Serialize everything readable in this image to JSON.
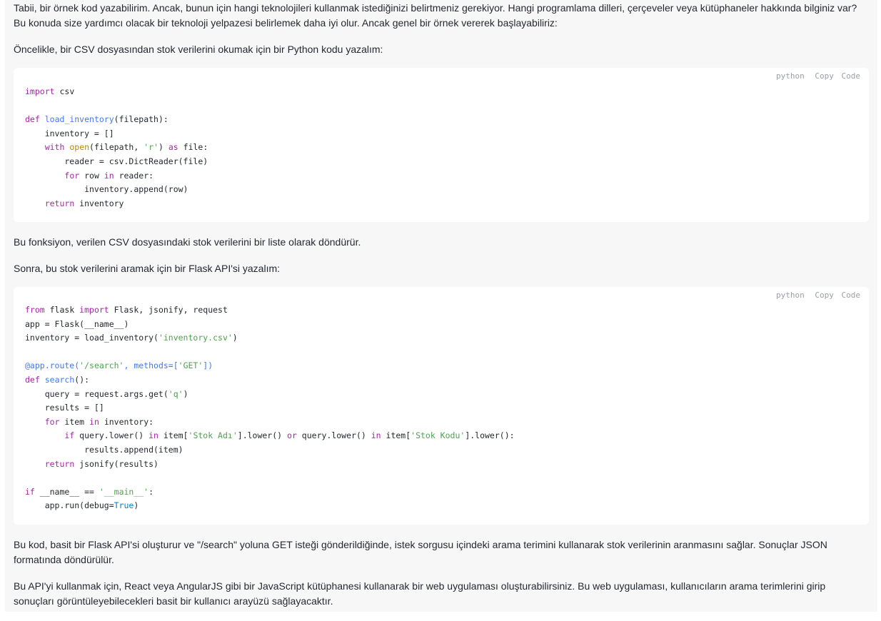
{
  "paragraphs": {
    "intro": "Tabii, bir örnek kod yazabilirim. Ancak, bunun için hangi teknolojileri kullanmak istediğinizi belirtmeniz gerekiyor. Hangi programlama dilleri, çerçeveler veya kütüphaneler hakkında bilginiz var? Bu konuda size yardımcı olacak bir teknoloji yelpazesi belirlemek daha iyi olur. Ancak genel bir örnek vererek başlayabiliriz:",
    "csv_intro": "Öncelikle, bir CSV dosyasından stok verilerini okumak için bir Python kodu yazalım:",
    "csv_explain": "Bu fonksiyon, verilen CSV dosyasındaki stok verilerini bir liste olarak döndürür.",
    "flask_intro": "Sonra, bu stok verilerini aramak için bir Flask API'si yazalım:",
    "flask_explain": "Bu kod, basit bir Flask API'si oluşturur ve \"/search\" yoluna GET isteği gönderildiğinde, istek sorgusu içindeki arama terimini kullanarak stok verilerinin aranmasını sağlar. Sonuçlar JSON formatında döndürülür.",
    "react_note": "Bu API'yi kullanmak için, React veya AngularJS gibi bir JavaScript kütüphanesi kullanarak bir web uygulaması oluşturabilirsiniz. Bu web uygulaması, kullanıcıların arama terimlerini girip sonuçları görüntüleyebilecekleri basit bir kullanıcı arayüzü sağlayacaktır."
  },
  "code_blocks": [
    {
      "language": "python",
      "copy_label": "Copy",
      "code_label": "Code",
      "lines": [
        [
          {
            "t": "import",
            "c": "kw"
          },
          {
            "t": " csv"
          }
        ],
        [],
        [
          {
            "t": "def",
            "c": "kw"
          },
          {
            "t": " "
          },
          {
            "t": "load_inventory",
            "c": "fn"
          },
          {
            "t": "(filepath):"
          }
        ],
        [
          {
            "t": "    inventory = []"
          }
        ],
        [
          {
            "t": "    "
          },
          {
            "t": "with",
            "c": "kw"
          },
          {
            "t": " "
          },
          {
            "t": "open",
            "c": "bi"
          },
          {
            "t": "(filepath, "
          },
          {
            "t": "'r'",
            "c": "st"
          },
          {
            "t": ") "
          },
          {
            "t": "as",
            "c": "kw"
          },
          {
            "t": " file:"
          }
        ],
        [
          {
            "t": "        reader = csv.DictReader(file)"
          }
        ],
        [
          {
            "t": "        "
          },
          {
            "t": "for",
            "c": "kw"
          },
          {
            "t": " row "
          },
          {
            "t": "in",
            "c": "kw"
          },
          {
            "t": " reader:"
          }
        ],
        [
          {
            "t": "            inventory.append(row)"
          }
        ],
        [
          {
            "t": "    "
          },
          {
            "t": "return",
            "c": "kw"
          },
          {
            "t": " inventory"
          }
        ]
      ]
    },
    {
      "language": "python",
      "copy_label": "Copy",
      "code_label": "Code",
      "lines": [
        [
          {
            "t": "from",
            "c": "kw"
          },
          {
            "t": " flask "
          },
          {
            "t": "import",
            "c": "kw"
          },
          {
            "t": " Flask, jsonify, request"
          }
        ],
        [
          {
            "t": "app = Flask(__name__)"
          }
        ],
        [
          {
            "t": "inventory = load_inventory("
          },
          {
            "t": "'inventory.csv'",
            "c": "st"
          },
          {
            "t": ")"
          }
        ],
        [],
        [
          {
            "t": "@app.route(",
            "c": "dec"
          },
          {
            "t": "'/search'",
            "c": "st"
          },
          {
            "t": ", methods=[",
            "c": "dec"
          },
          {
            "t": "'GET'",
            "c": "st"
          },
          {
            "t": "])",
            "c": "dec"
          }
        ],
        [
          {
            "t": "def",
            "c": "kw"
          },
          {
            "t": " "
          },
          {
            "t": "search",
            "c": "fn"
          },
          {
            "t": "():"
          }
        ],
        [
          {
            "t": "    query = request.args.get("
          },
          {
            "t": "'q'",
            "c": "st"
          },
          {
            "t": ")"
          }
        ],
        [
          {
            "t": "    results = []"
          }
        ],
        [
          {
            "t": "    "
          },
          {
            "t": "for",
            "c": "kw"
          },
          {
            "t": " item "
          },
          {
            "t": "in",
            "c": "kw"
          },
          {
            "t": " inventory:"
          }
        ],
        [
          {
            "t": "        "
          },
          {
            "t": "if",
            "c": "kw"
          },
          {
            "t": " query.lower() "
          },
          {
            "t": "in",
            "c": "kw"
          },
          {
            "t": " item["
          },
          {
            "t": "'Stok Adı'",
            "c": "st"
          },
          {
            "t": "].lower() "
          },
          {
            "t": "or",
            "c": "kw"
          },
          {
            "t": " query.lower() "
          },
          {
            "t": "in",
            "c": "kw"
          },
          {
            "t": " item["
          },
          {
            "t": "'Stok Kodu'",
            "c": "st"
          },
          {
            "t": "].lower():"
          }
        ],
        [
          {
            "t": "            results.append(item)"
          }
        ],
        [
          {
            "t": "    "
          },
          {
            "t": "return",
            "c": "kw"
          },
          {
            "t": " jsonify(results)"
          }
        ],
        [],
        [
          {
            "t": "if",
            "c": "kw"
          },
          {
            "t": " __name__ == "
          },
          {
            "t": "'__main__'",
            "c": "st"
          },
          {
            "t": ":"
          }
        ],
        [
          {
            "t": "    app.run(debug="
          },
          {
            "t": "True",
            "c": "num"
          },
          {
            "t": ")"
          }
        ]
      ]
    }
  ]
}
